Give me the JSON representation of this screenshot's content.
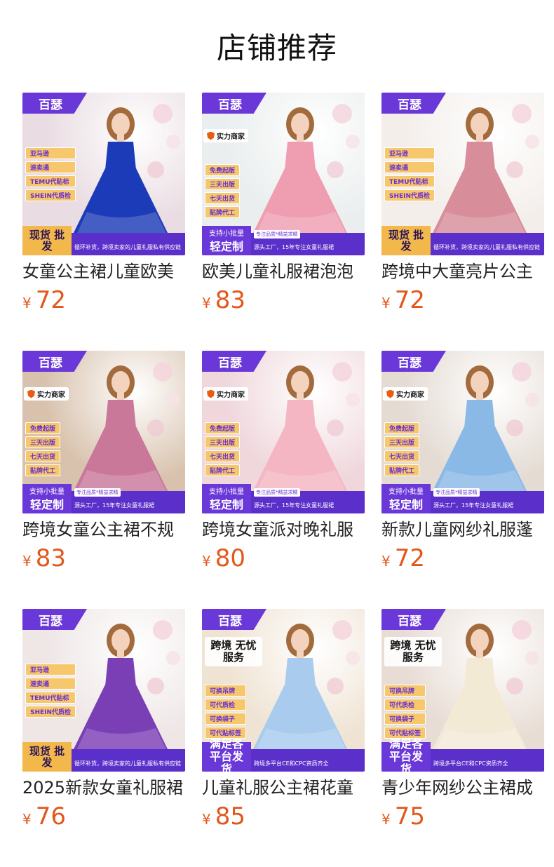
{
  "header": {
    "title": "店铺推荐"
  },
  "products": [
    {
      "title": "女童公主裙儿童欧美",
      "currency": "¥",
      "price": "72",
      "image": {
        "brand": "百瑟",
        "variant": "A",
        "tags": [
          "亚马逊",
          "速卖通",
          "TEMU代贴标",
          "SHEIN代质检"
        ],
        "bottom_left": "现货 批发",
        "bottom_text": "循环补货，跨境卖家的儿童礼服私有供应链",
        "dress_color": "#1c3bb8",
        "bg_color": "#e9dce2"
      }
    },
    {
      "title": "欧美儿童礼服裙泡泡",
      "currency": "¥",
      "price": "83",
      "image": {
        "brand": "百瑟",
        "variant": "B",
        "strong": "实力商家",
        "tags": [
          "免费起版",
          "三天出版",
          "七天出货",
          "贴牌代工"
        ],
        "bottom_left_small": "支持小批量",
        "bottom_left": "轻定制",
        "bottom_mini": "专注品质*精益求精",
        "bottom_text": "源头工厂，15年专注女童礼服裙",
        "dress_color": "#ef9eb1",
        "bg_color": "#eaeeee"
      }
    },
    {
      "title": "跨境中大童亮片公主",
      "currency": "¥",
      "price": "72",
      "image": {
        "brand": "百瑟",
        "variant": "A",
        "tags": [
          "亚马逊",
          "速卖通",
          "TEMU代贴标",
          "SHEIN代质检"
        ],
        "bottom_left": "现货 批发",
        "bottom_text": "循环补货，跨境卖家的儿童礼服私有供应链",
        "dress_color": "#d78e9a",
        "bg_color": "#f3eeea"
      }
    },
    {
      "title": "跨境女童公主裙不规",
      "currency": "¥",
      "price": "83",
      "image": {
        "brand": "百瑟",
        "variant": "B",
        "strong": "实力商家",
        "tags": [
          "免费起版",
          "三天出版",
          "七天出货",
          "贴牌代工"
        ],
        "bottom_left_small": "支持小批量",
        "bottom_left": "轻定制",
        "bottom_mini": "专注品质*精益求精",
        "bottom_text": "源头工厂，15年专注女童礼服裙",
        "dress_color": "#c9789a",
        "bg_color": "#d8c2ad"
      }
    },
    {
      "title": "跨境女童派对晚礼服",
      "currency": "¥",
      "price": "80",
      "image": {
        "brand": "百瑟",
        "variant": "B",
        "strong": "实力商家",
        "tags": [
          "免费起版",
          "三天出版",
          "七天出货",
          "贴牌代工"
        ],
        "bottom_left_small": "支持小批量",
        "bottom_left": "轻定制",
        "bottom_mini": "专注品质*精益求精",
        "bottom_text": "源头工厂，15年专注女童礼服裙",
        "dress_color": "#f4b6c2",
        "bg_color": "#efd7dc"
      }
    },
    {
      "title": "新款儿童网纱礼服蓬",
      "currency": "¥",
      "price": "72",
      "image": {
        "brand": "百瑟",
        "variant": "B",
        "strong": "实力商家",
        "tags": [
          "免费起版",
          "三天出版",
          "七天出货",
          "贴牌代工"
        ],
        "bottom_left_small": "支持小批量",
        "bottom_left": "轻定制",
        "bottom_mini": "专注品质*精益求精",
        "bottom_text": "源头工厂，15年专注女童礼服裙",
        "dress_color": "#8ab9e6",
        "bg_color": "#e4dbd3"
      }
    },
    {
      "title": "2025新款女童礼服裙",
      "currency": "¥",
      "price": "76",
      "image": {
        "brand": "百瑟",
        "variant": "A",
        "tags": [
          "亚马逊",
          "速卖通",
          "TEMU代贴标",
          "SHEIN代质检"
        ],
        "bottom_left": "现货 批发",
        "bottom_text": "循环补货，跨境卖家的儿童礼服私有供应链",
        "dress_color": "#7b3fb5",
        "bg_color": "#efe6e6"
      }
    },
    {
      "title": "儿童礼服公主裙花童",
      "currency": "¥",
      "price": "85",
      "image": {
        "brand": "百瑟",
        "variant": "C",
        "big_title": "跨境 无忧服务",
        "tags": [
          "可换吊牌",
          "可代质检",
          "可换袋子",
          "可代贴标签"
        ],
        "bottom_left": "满足各 平台发货",
        "bottom_text": "跨境多平台CE和CPC资质齐全",
        "dress_color": "#a8cbee",
        "bg_color": "#efe3d3"
      }
    },
    {
      "title": "青少年网纱公主裙成",
      "currency": "¥",
      "price": "75",
      "image": {
        "brand": "百瑟",
        "variant": "C",
        "big_title": "跨境 无忧服务",
        "tags": [
          "可换吊牌",
          "可代质检",
          "可换袋子",
          "可代贴标签"
        ],
        "bottom_left": "满足各 平台发货",
        "bottom_text": "跨境多平台CE和CPC资质齐全",
        "dress_color": "#f3ead6",
        "bg_color": "#e8ddd5"
      }
    }
  ]
}
